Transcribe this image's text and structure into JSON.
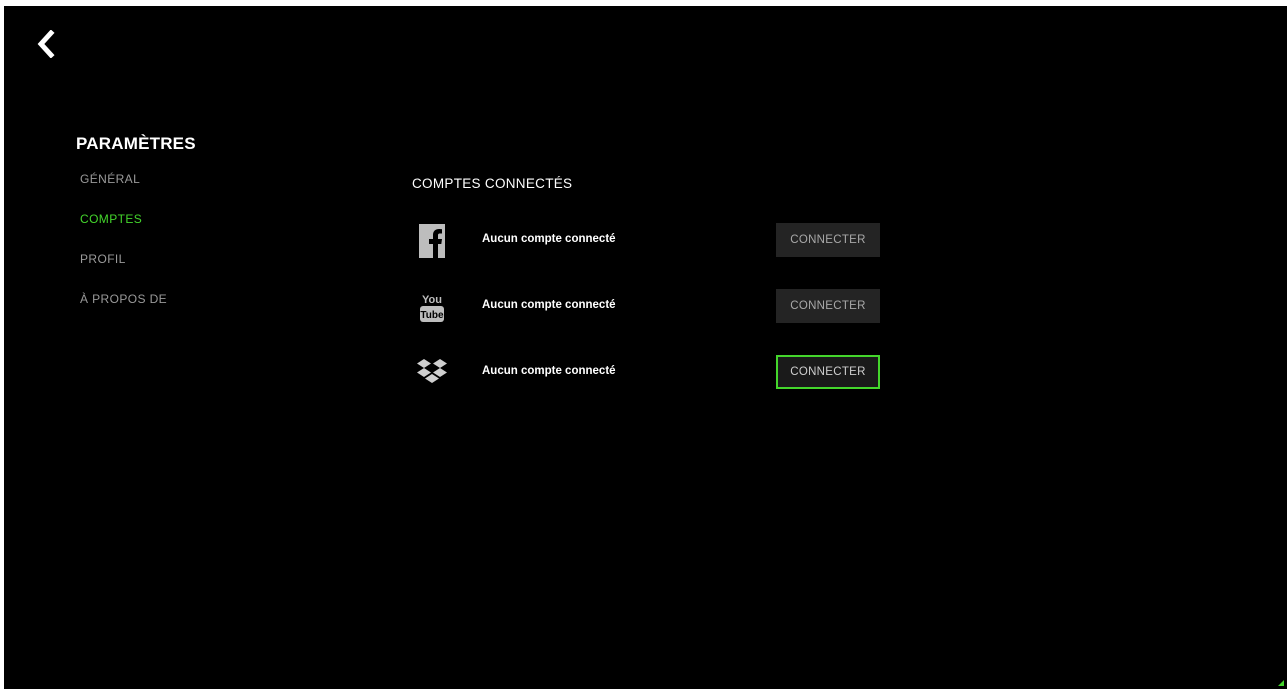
{
  "sidebar": {
    "title": "PARAMÈTRES",
    "items": [
      {
        "label": "GÉNÉRAL",
        "active": false
      },
      {
        "label": "COMPTES",
        "active": true
      },
      {
        "label": "PROFIL",
        "active": false
      },
      {
        "label": "À PROPOS DE",
        "active": false
      }
    ]
  },
  "main": {
    "section_title": "COMPTES CONNECTÉS",
    "accounts": [
      {
        "service_icon": "facebook-icon",
        "status": "Aucun compte connecté",
        "button_label": "CONNECTER"
      },
      {
        "service_icon": "youtube-icon",
        "status": "Aucun compte connecté",
        "button_label": "CONNECTER"
      },
      {
        "service_icon": "dropbox-icon",
        "status": "Aucun compte connecté",
        "button_label": "CONNECTER"
      }
    ]
  },
  "icons": {
    "back": "chevron-left-icon"
  },
  "colors": {
    "background": "#000000",
    "accent": "#44d62c",
    "inactive_text": "#9a9a9a",
    "button_bg": "#242424"
  }
}
